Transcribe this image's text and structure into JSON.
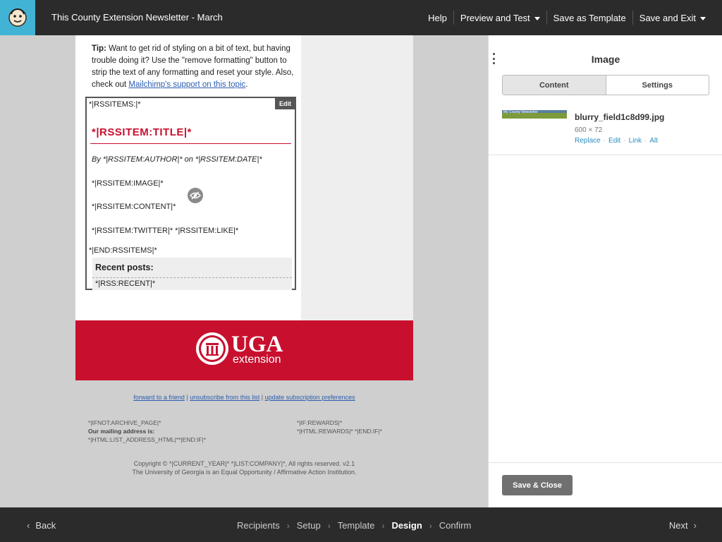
{
  "header": {
    "title": "This County Extension Newsletter - March",
    "actions": [
      {
        "label": "Help",
        "dropdown": false
      },
      {
        "label": "Preview and Test",
        "dropdown": true
      },
      {
        "label": "Save as Template",
        "dropdown": false
      },
      {
        "label": "Save and Exit",
        "dropdown": true
      }
    ]
  },
  "email": {
    "tip": {
      "lead": "Tip:",
      "text": " Want to get rid of styling on a bit of text, but having trouble doing it? Use the \"remove formatting\" button to strip the text of any formatting and reset your style. Also, check out ",
      "link": "Mailchimp's support on this topic",
      "end": "."
    },
    "rss": {
      "edit_label": "Edit",
      "items_open": "*|RSSITEMS:|*",
      "title": "*|RSSITEM:TITLE|*",
      "author_line": "By *|RSSITEM:AUTHOR|* on *|RSSITEM:DATE|*",
      "image": "*|RSSITEM:IMAGE|*",
      "content": "*|RSSITEM:CONTENT|*",
      "social": "*|RSSITEM:TWITTER|* *|RSSITEM:LIKE|*",
      "items_close": "*|END:RSSITEMS|*",
      "recent_title": "Recent posts:",
      "recent_tag": "*|RSS:RECENT|*"
    },
    "banner": {
      "brand": "UGA",
      "sub": "extension",
      "color": "#c8102e"
    },
    "footer": {
      "link_forward": "forward to a friend",
      "link_unsub": "unsubscribe from this list",
      "link_prefs": "update subscription preferences",
      "separator": " | ",
      "left_line1": "*|IFNOT:ARCHIVE_PAGE|*",
      "left_line2": "Our mailing address is:",
      "left_line3": "*|HTML:LIST_ADDRESS_HTML|**|END:IF|*",
      "right_line1": "*|IF:REWARDS|*",
      "right_line2": "*|HTML:REWARDS|* *|END:IF|*",
      "copyright1": "Copyright © *|CURRENT_YEAR|* *|LIST:COMPANY|*, All rights reserved. v2.1",
      "copyright2": "The University of Georgia is an Equal Opportunity / Affirmative Action Institution."
    }
  },
  "panel": {
    "title": "Image",
    "tabs": [
      {
        "label": "Content",
        "active": true
      },
      {
        "label": "Settings",
        "active": false
      }
    ],
    "image": {
      "thumb_text": "My County Newsletter",
      "filename": "blurry_field1c8d99.jpg",
      "dimensions": "600 × 72",
      "actions": [
        "Replace",
        "Edit",
        "Link",
        "Alt"
      ]
    },
    "save_label": "Save & Close"
  },
  "nav": {
    "back": "Back",
    "next": "Next",
    "steps": [
      {
        "label": "Recipients",
        "current": false
      },
      {
        "label": "Setup",
        "current": false
      },
      {
        "label": "Template",
        "current": false
      },
      {
        "label": "Design",
        "current": true
      },
      {
        "label": "Confirm",
        "current": false
      }
    ]
  },
  "colors": {
    "topbar": "#2b2b2b",
    "logo_bg": "#41b4d6",
    "accent_red": "#c8102e",
    "link_blue": "#2a8ec2"
  },
  "icons": {
    "logo": "mailchimp-freddie-icon",
    "visibility": "eye-hidden-icon",
    "menu": "kebab-menu-icon"
  }
}
